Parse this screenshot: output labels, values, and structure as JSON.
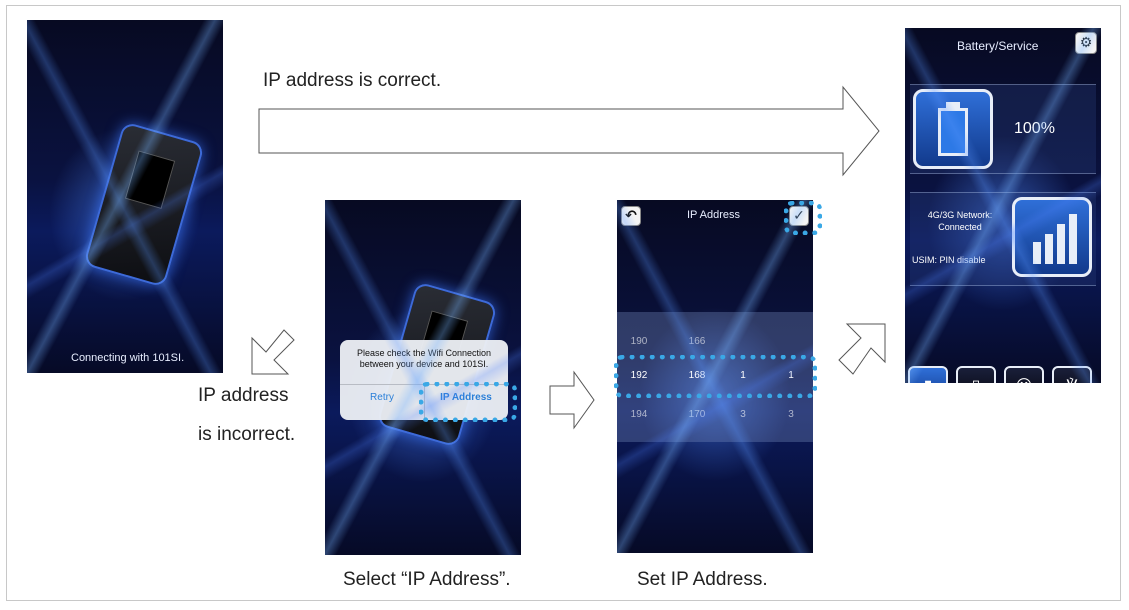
{
  "captions": {
    "correct": "IP address is correct.",
    "incorrect_line1": "IP address",
    "incorrect_line2": "is incorrect.",
    "select": "Select “IP Address”.",
    "set": "Set IP Address."
  },
  "screen1": {
    "status": "Connecting with 101SI."
  },
  "screen2": {
    "message": "Please check the Wifi Connection between your device and 101SI.",
    "retry": "Retry",
    "ip_address": "IP Address"
  },
  "screen3": {
    "title": "IP Address",
    "back_icon": "back-arrow-icon",
    "confirm_icon": "checkmark-icon",
    "rows": [
      [
        "190",
        "166",
        "",
        ""
      ],
      [
        "192",
        "168",
        "1",
        "1"
      ],
      [
        "194",
        "170",
        "3",
        "3"
      ]
    ]
  },
  "screen4": {
    "title": "Battery/Service",
    "battery_level": "100%",
    "network_status": "4G/3G Network: Connected",
    "usim_status": "USIM: PIN disable",
    "tabs": [
      "battery-signal-icon",
      "device-icon",
      "user-wireless-icon",
      "antenna-icon"
    ]
  },
  "colors": {
    "highlight": "#3aa8e6",
    "link": "#2a7fd8",
    "panel_blue": "#1a4fb8"
  }
}
